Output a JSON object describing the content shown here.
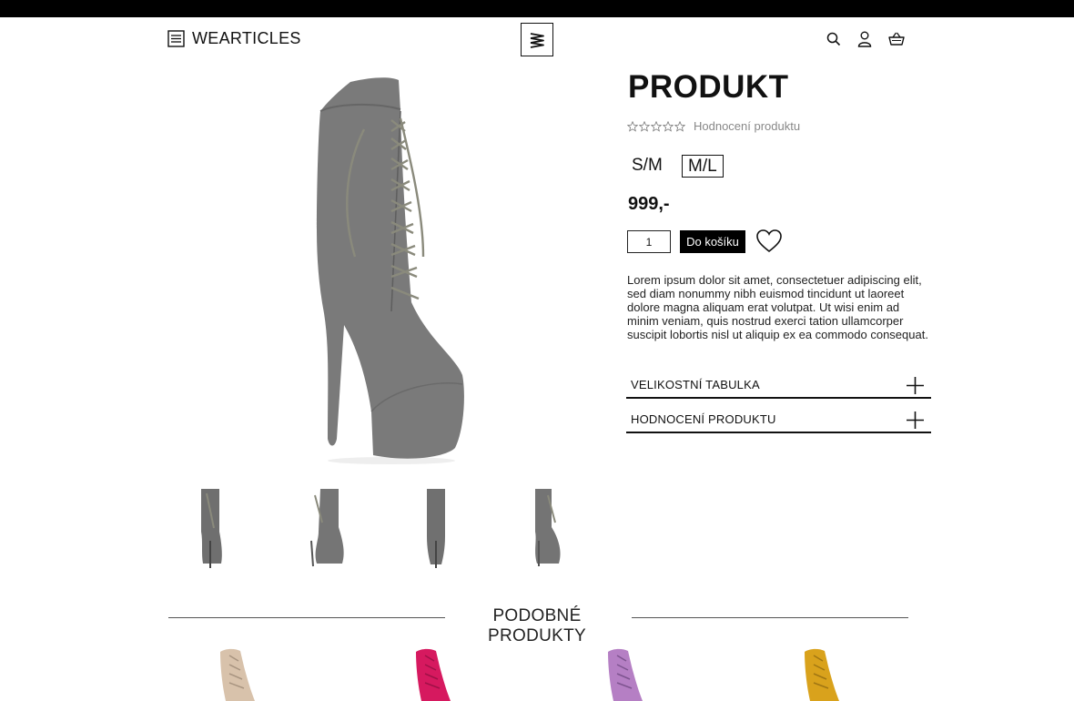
{
  "header": {
    "brand_name": "WEARTICLES"
  },
  "product": {
    "title": "PRODUKT",
    "rating_label": "Hodnocení produktu",
    "rating_stars": 0,
    "rating_max": 5,
    "sizes": [
      "S/M",
      "M/L"
    ],
    "selected_size": "M/L",
    "price": "999,-",
    "quantity": "1",
    "add_to_cart_label": "Do košíku",
    "description": "Lorem ipsum dolor sit amet, consectetuer adipiscing elit, sed diam nonummy nibh euismod tincidunt ut laoreet dolore magna aliquam erat volutpat. Ut wisi enim ad minim veniam, quis nostrud exerci tation ullamcorper suscipit lobortis nisl ut aliquip ex ea commodo consequat.",
    "accordions": [
      {
        "label": "VELIKOSTNÍ TABULKA"
      },
      {
        "label": "HODNOCENÍ PRODUKTU"
      }
    ],
    "boot_color": "#7a7a7a"
  },
  "similar": {
    "title": "PODOBNÉ PRODUKTY",
    "colors": [
      "#d8c2ab",
      "#d6195f",
      "#b57fc4",
      "#d9a21c"
    ]
  }
}
